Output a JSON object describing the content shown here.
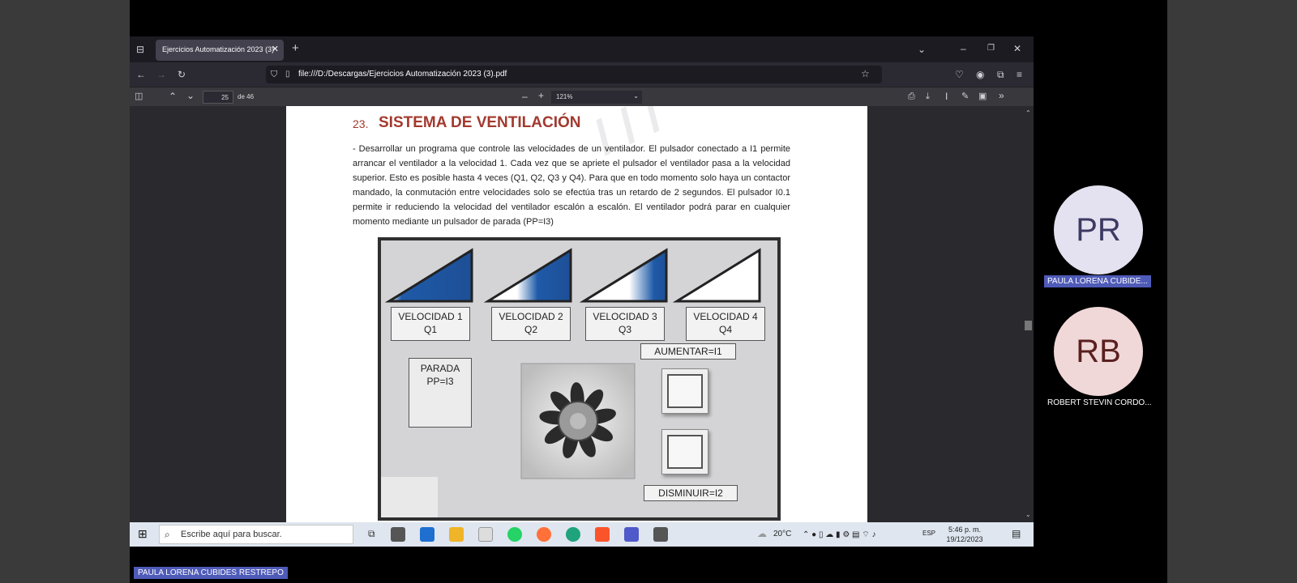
{
  "browser": {
    "tab_title": "Ejercicios Automatización 2023 (3)",
    "tab_close": "✕",
    "new_tab": "+",
    "url": "file:///D:/Descargas/Ejercicios Automatización 2023 (3).pdf"
  },
  "pdf_toolbar": {
    "page_number": "25",
    "page_total": "de 46",
    "zoom": "121%"
  },
  "document": {
    "section_number": "23.",
    "section_title": "SISTEMA DE VENTILACIÓN",
    "paragraph": "- Desarrollar un programa que controle las velocidades de un ventilador. El pulsador conectado a I1 permite arrancar el ventilador a la velocidad 1. Cada vez que se apriete el pulsador el ventilador pasa a la velocidad superior. Esto es posible hasta 4 veces (Q1, Q2, Q3 y Q4). Para que en todo momento solo haya un contactor mandado, la conmutación entre velocidades solo se efectúa tras un retardo de 2 segundos. El pulsador I0.1 permite ir reduciendo la velocidad del ventilador escalón a escalón. El ventilador podrá parar en cualquier momento mediante un pulsador de parada (PP=I3)",
    "panel": {
      "speeds": [
        {
          "line1": "VELOCIDAD 1",
          "line2": "Q1"
        },
        {
          "line1": "VELOCIDAD 2",
          "line2": "Q2"
        },
        {
          "line1": "VELOCIDAD 3",
          "line2": "Q3"
        },
        {
          "line1": "VELOCIDAD 4",
          "line2": "Q4"
        }
      ],
      "stop_line1": "PARADA",
      "stop_line2": "PP=I3",
      "increase_label": "AUMENTAR=I1",
      "decrease_label": "DISMINUIR=I2"
    }
  },
  "taskbar": {
    "search_placeholder": "Escribe aquí para buscar.",
    "weather": "20°C",
    "language": "ESP",
    "time": "5:46 p. m.",
    "date": "19/12/2023"
  },
  "participants": [
    {
      "initials": "PR",
      "name": "PAULA LORENA CUBIDE...",
      "bg": "#e4e2f0",
      "fg": "#3d3a63"
    },
    {
      "initials": "RB",
      "name": "ROBERT STEVIN CORDO...",
      "bg": "#f0d8d8",
      "fg": "#5a1f1f"
    }
  ],
  "presenter_name": "PAULA LORENA CUBIDES RESTREPO",
  "colors": {
    "heading": "#a3392e",
    "speed_blue": "#1e5aa8",
    "stop_red": "#d42020"
  }
}
